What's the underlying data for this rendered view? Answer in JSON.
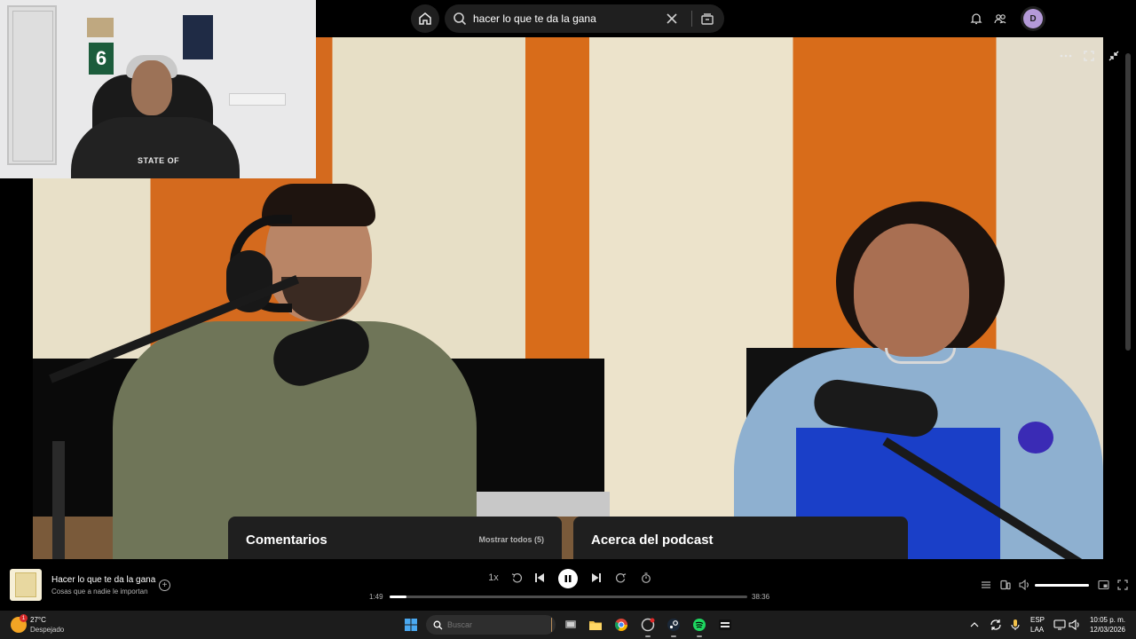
{
  "search": {
    "value": "hacer lo que te da la gana"
  },
  "account": {
    "initial": "D"
  },
  "webcam": {
    "poster_number": "6",
    "shirt_text": "STATE OF"
  },
  "panels": {
    "comments_title": "Comentarios",
    "comments_link": "Mostrar todos (5)",
    "about_title": "Acerca del podcast"
  },
  "player": {
    "title": "Hacer lo que te da la gana",
    "subtitle": "Cosas que a nadie le importan",
    "speed": "1x",
    "current_time": "1:49",
    "total_time": "38:36",
    "progress_fraction": 0.047,
    "volume_fraction": 1.0
  },
  "taskbar": {
    "temperature": "27°C",
    "weather": "Despejado",
    "weather_badge": "1",
    "search_placeholder": "Buscar",
    "lang1": "ESP",
    "lang2": "LAA",
    "time": "10:05 p. m.",
    "date": "12/03/2026"
  },
  "colors": {
    "accent_wall": "#d86c1a",
    "panel_bg": "#1f1f1f",
    "avatar": "#b49ad8"
  },
  "icons": [
    "home-icon",
    "search-icon",
    "close-icon",
    "browse-icon",
    "bell-icon",
    "friends-icon",
    "more-icon",
    "fullscreen-icon",
    "minimize-icon",
    "add-icon",
    "skip-back-15-icon",
    "previous-icon",
    "pause-icon",
    "next-icon",
    "skip-forward-15-icon",
    "sleep-timer-icon",
    "queue-icon",
    "connect-device-icon",
    "volume-icon",
    "miniplayer-icon",
    "expand-icon"
  ]
}
